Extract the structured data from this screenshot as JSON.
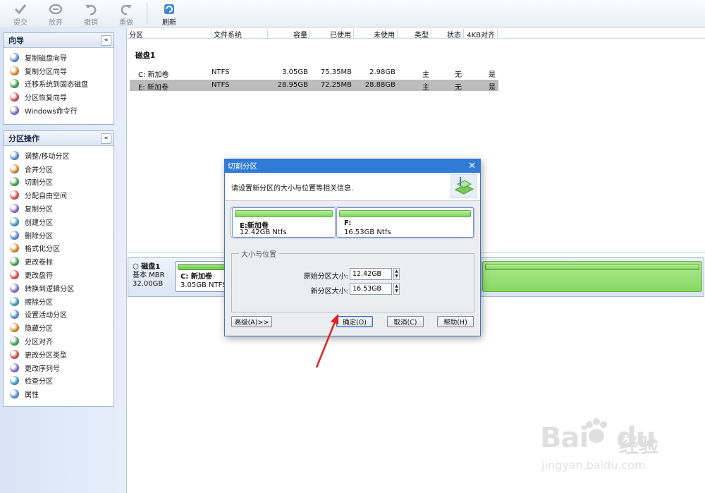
{
  "toolbar": {
    "buttons": [
      {
        "label": "提交",
        "icon": "check-icon",
        "enabled": false
      },
      {
        "label": "放弃",
        "icon": "discard-icon",
        "enabled": false
      },
      {
        "label": "撤销",
        "icon": "undo-icon",
        "enabled": false
      },
      {
        "label": "重做",
        "icon": "redo-icon",
        "enabled": false
      },
      {
        "label": "刷新",
        "icon": "refresh-icon",
        "enabled": true
      }
    ]
  },
  "wizard_panel": {
    "title": "向导",
    "collapse": "«",
    "items": [
      "复制磁盘向导",
      "复制分区向导",
      "迁移系统到固态磁盘",
      "分区恢复向导",
      "Windows命令行"
    ]
  },
  "ops_panel": {
    "title": "分区操作",
    "collapse": "«",
    "items": [
      "调整/移动分区",
      "合并分区",
      "切割分区",
      "分配自由空间",
      "复制分区",
      "创建分区",
      "删除分区",
      "格式化分区",
      "更改卷标",
      "更改盘符",
      "转换到逻辑分区",
      "擦除分区",
      "设置活动分区",
      "隐藏分区",
      "分区对齐",
      "更改分区类型",
      "更改序列号",
      "检查分区",
      "属性"
    ]
  },
  "table": {
    "columns": [
      "分区",
      "文件系统",
      "容量",
      "已使用",
      "未使用",
      "类型",
      "状态",
      "4KB对齐"
    ],
    "disk_label": "磁盘1",
    "rows": [
      {
        "partition": "C: 新加卷",
        "fs": "NTFS",
        "capacity": "3.05GB",
        "used": "75.35MB",
        "free": "2.98GB",
        "type": "主",
        "status": "无",
        "aligned": "是",
        "selected": false
      },
      {
        "partition": "E: 新加卷",
        "fs": "NTFS",
        "capacity": "28.95GB",
        "used": "72.25MB",
        "free": "28.88GB",
        "type": "主",
        "status": "无",
        "aligned": "是",
        "selected": true
      }
    ]
  },
  "disk_map": {
    "name": "磁盘1",
    "type": "基本 MBR",
    "size": "32.00GB",
    "part_c_name": "C: 新加卷",
    "part_c_info": "3.05GB NTFS"
  },
  "dialog": {
    "title": "切割分区",
    "close": "✕",
    "instruction": "请设置新分区的大小与位置等相关信息.",
    "part1_name": "E:新加卷",
    "part1_size": "12.42GB Ntfs",
    "part2_name": "F:",
    "part2_size": "16.53GB Ntfs",
    "group_title": "大小与位置",
    "orig_label": "原始分区大小:",
    "orig_value": "12.42GB",
    "new_label": "新分区大小:",
    "new_value": "16.53GB",
    "advanced_btn": "高级(A)>>",
    "ok_btn": "确定(O)",
    "cancel_btn": "取消(C)",
    "help_btn": "帮助(H)"
  },
  "watermark": {
    "logo": "Bai",
    "logo2": "du",
    "jingyan": "经验",
    "url": "jingyan.baidu.com"
  },
  "colors": {
    "title_blue": "#2f7bd6",
    "partition_green": "#7dd65b",
    "annotation_red": "#e02020"
  }
}
